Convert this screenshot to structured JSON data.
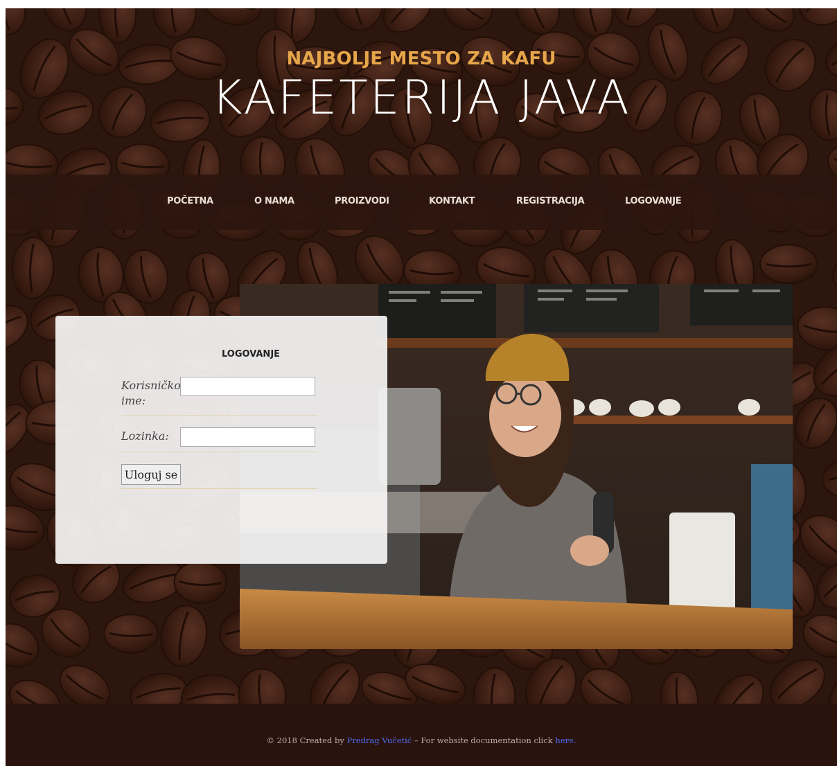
{
  "header": {
    "subtitle": "NAJBOLJE MESTO ZA KAFU",
    "title": "KAFETERIJA JAVA"
  },
  "nav": {
    "items": [
      {
        "label": "POČETNA"
      },
      {
        "label": "O NAMA"
      },
      {
        "label": "PROIZVODI"
      },
      {
        "label": "KONTAKT"
      },
      {
        "label": "REGISTRACIJA"
      },
      {
        "label": "LOGOVANJE"
      }
    ]
  },
  "login": {
    "title": "LOGOVANJE",
    "username_label": "Korisničko ime:",
    "username_value": "",
    "password_label": "Lozinka:",
    "password_value": "",
    "submit_label": "Uloguj se"
  },
  "footer": {
    "prefix": "© 2018 Created by ",
    "author": "Predrag Vučetić",
    "middle": " – For website documentation click ",
    "link": "here."
  },
  "colors": {
    "accent": "#e6a64a",
    "nav_bg": "#2d160e",
    "footer_bg": "#2b130d",
    "link": "#4a6cf0"
  }
}
